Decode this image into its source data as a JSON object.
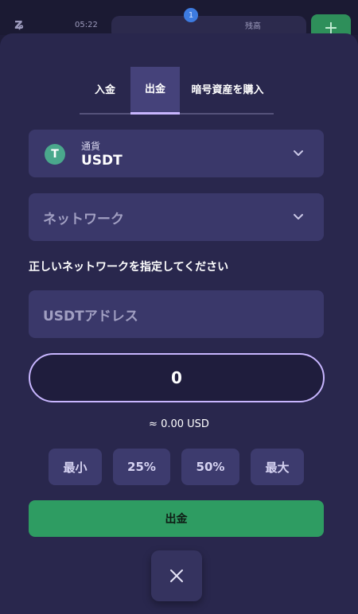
{
  "topbar": {
    "time": "05:22",
    "badge_count": "1",
    "pill_text": "残高",
    "plus_label": "+"
  },
  "tabs": [
    {
      "label": "入金",
      "active": false
    },
    {
      "label": "出金",
      "active": true
    },
    {
      "label": "暗号資産を購入",
      "active": false
    }
  ],
  "currency": {
    "label": "通貨",
    "value": "USDT",
    "icon": "tether-icon"
  },
  "network": {
    "placeholder": "ネットワーク"
  },
  "hint": "正しいネットワークを指定してください",
  "address": {
    "placeholder": "USDTアドレス"
  },
  "amount": {
    "value": "0",
    "approx": "≈ 0.00 USD"
  },
  "quick_buttons": [
    "最小",
    "25%",
    "50%",
    "最大"
  ],
  "submit_label": "出金",
  "colors": {
    "background": "#29274d",
    "field": "#3a386a",
    "accent": "#c8b6ff",
    "submit": "#2e9c62"
  }
}
